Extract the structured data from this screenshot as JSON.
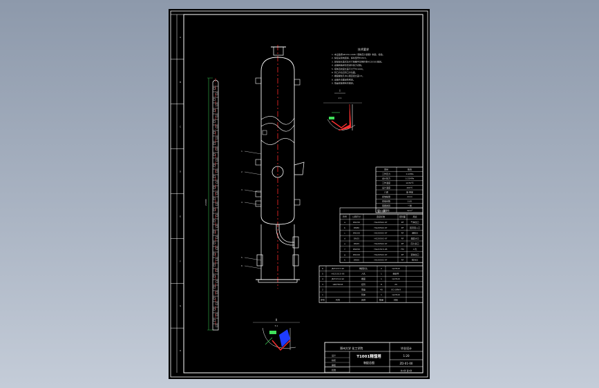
{
  "colors": {
    "background_top": "#8d99ab",
    "background_bottom": "#c4ccd8",
    "sheet": "#000000",
    "linework": "#ffffff",
    "centerline": "#ff2a2a",
    "dimension": "#3fe05a",
    "hatch": "#ff3030",
    "detail_fill": "#1e3cff"
  },
  "drawing": {
    "zone_letters": [
      "A",
      "B",
      "C",
      "D",
      "E",
      "F",
      "G",
      "H"
    ],
    "zone_numbers": [
      "1",
      "2",
      "3",
      "4",
      "5",
      "6",
      "7",
      "8"
    ],
    "tech_req_title": "技术要求",
    "tech_req_lines": [
      "1. 本设备按GB150-1998《钢制压力容器》制造、检验。",
      "2. 焊接采用电弧焊，焊条型号E4303。",
      "3. 焊接接头型式及尺寸除图中注明外按HG20583规定。",
      "4. 设备制造完毕后进行压力试验。",
      "5. 塔体直线度允差不大于H/1000。",
      "6. 管口方位见管口方位图。",
      "7. 裙座螺栓孔中心圆直径允差±3。",
      "8. 设备外表面涂防锈漆。",
      "9. 塔盘安装按有关规定。"
    ],
    "detail_one": "I",
    "detail_two": "II",
    "scale_one": "2:1",
    "scale_two": "5:1",
    "part_callouts": [
      "1",
      "2",
      "3",
      "4",
      "5",
      "6"
    ],
    "height_dim": "24000",
    "tech_table": {
      "title": "技术特性表",
      "rows": [
        [
          "项目",
          "数值"
        ],
        [
          "工作压力",
          "0.1MPa"
        ],
        [
          "设计压力",
          "0.25MPa"
        ],
        [
          "工作温度",
          "≤150℃"
        ],
        [
          "设计温度",
          "200℃"
        ],
        [
          "介质",
          "苯-甲苯"
        ],
        [
          "腐蚀裕量",
          "2mm"
        ],
        [
          "焊缝系数",
          "0.85"
        ],
        [
          "容器类别",
          "一类"
        ],
        [
          "全容积",
          "32m³"
        ]
      ]
    },
    "nozzle_table": {
      "title": "管口表",
      "header": [
        "符号",
        "公称尺寸",
        "连接标准",
        "密封面",
        "用途"
      ],
      "rows": [
        [
          "a",
          "DN150",
          "HG20592-97",
          "RF",
          "气体出口"
        ],
        [
          "b",
          "DN80",
          "HG20592-97",
          "RF",
          "回流液入口"
        ],
        [
          "c",
          "DN100",
          "HG20592-97",
          "RF",
          "进料口"
        ],
        [
          "d",
          "DN25",
          "HG20592-97",
          "RF",
          "温度计口"
        ],
        [
          "e",
          "DN25",
          "HG20592-97",
          "RF",
          "压力表口"
        ],
        [
          "f",
          "DN450",
          "HG21515-95",
          "FM",
          "人孔"
        ],
        [
          "g",
          "DN100",
          "HG20592-97",
          "RF",
          "液体出口"
        ],
        [
          "h",
          "DN50",
          "HG20592-97",
          "RF",
          "排污口"
        ]
      ]
    },
    "bom": {
      "rows": [
        [
          "6",
          "JB/T4737-95",
          "椭圆封头",
          "2",
          "Q235-B"
        ],
        [
          "5",
          "HG21515-95",
          "人孔",
          "1",
          "组合件"
        ],
        [
          "4",
          "JB/T4712-92",
          "裙座",
          "1",
          "Q235-B"
        ],
        [
          "3",
          "GB/T8163",
          "接管",
          "8",
          "20"
        ],
        [
          "2",
          "",
          "塔盘",
          "40",
          "0Cr18Ni9"
        ],
        [
          "1",
          "",
          "筒体",
          "1",
          "Q235-B"
        ]
      ],
      "header": [
        "序号",
        "代号",
        "名称",
        "数量",
        "材料"
      ]
    },
    "title_block": {
      "school": "郑州大学 化工学院",
      "drawing_name": "T1001精馏塔",
      "drawing_name2": "装配总图",
      "project": "毕业设计",
      "drawing_no": "ZD-01-00",
      "scale": "1:20",
      "sheet": "共1张 第1张",
      "roles": [
        "设计",
        "校核",
        "审核",
        "批准"
      ]
    }
  }
}
